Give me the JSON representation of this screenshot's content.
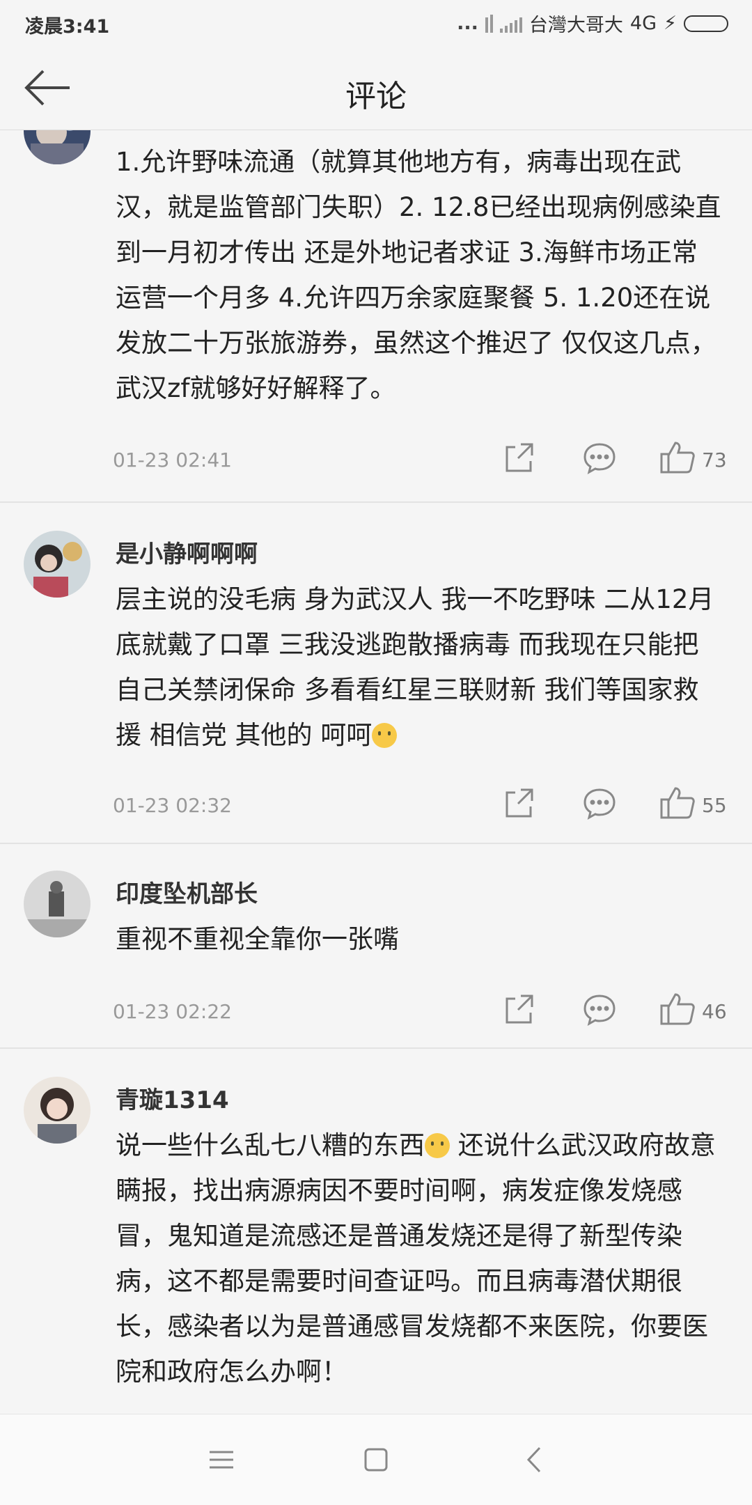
{
  "status_bar": {
    "time": "凌晨3:41",
    "dots": "...",
    "carrier": "台灣大哥大",
    "network": "4G"
  },
  "header": {
    "title": "评论",
    "back_icon": "back-arrow-icon"
  },
  "comments": [
    {
      "name": "",
      "text": "1.允许野味流通（就算其他地方有，病毒出现在武汉，就是监管部门失职）2. 12.8已经出现病例感染直到一月初才传出 还是外地记者求证  3.海鲜市场正常运营一个月多 4.允许四万余家庭聚餐    5. 1.20还在说发放二十万张旅游券，虽然这个推迟了  仅仅这几点，武汉zf就够好好解释了。",
      "date": "01-23 02:41",
      "likes": "73"
    },
    {
      "name": "是小静啊啊啊",
      "text": "层主说的没毛病 身为武汉人 我一不吃野味 二从12月底就戴了口罩 三我没逃跑散播病毒 而我现在只能把自己关禁闭保命 多看看红星三联财新 我们等国家救援 相信党 其他的 呵呵",
      "emoji": "smile-emoji",
      "date": "01-23 02:32",
      "likes": "55"
    },
    {
      "name": "印度坠机部长",
      "text": "重视不重视全靠你一张嘴",
      "date": "01-23 02:22",
      "likes": "46"
    },
    {
      "name": "青璇1314",
      "text_part1": "说一些什么乱七八糟的东西",
      "emoji": "thinking-emoji",
      "text_part2": " 还说什么武汉政府故意瞒报，找出病源病因不要时间啊，病发症像发烧感冒，鬼知道是流感还是普通发烧还是得了新型传染病，这不都是需要时间查证吗。而且病毒潜伏期很长，感染者以为是普通感冒发烧都不来医院，你要医院和政府怎么办啊！"
    }
  ],
  "icons": {
    "share": "share-icon",
    "reply": "comment-icon",
    "like": "thumbs-up-icon"
  },
  "colors": {
    "background": "#f5f5f5",
    "text": "#222222",
    "meta": "#999999",
    "divider": "#e3e3e3"
  }
}
